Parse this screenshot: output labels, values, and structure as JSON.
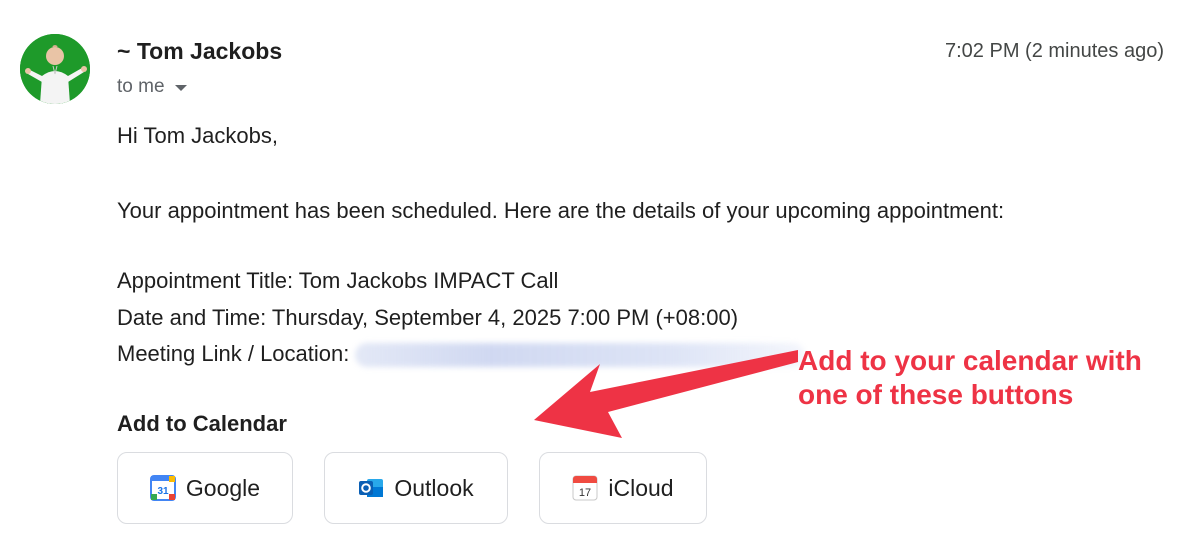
{
  "header": {
    "sender": "~ Tom Jackobs",
    "timestamp": "7:02 PM (2 minutes ago)",
    "recipient": "to me"
  },
  "body": {
    "greeting": "Hi Tom Jackobs,",
    "intro": "Your appointment has been scheduled. Here are the details of your upcoming appointment:",
    "title_line": "Appointment Title: Tom Jackobs IMPACT Call",
    "datetime_line": "Date and Time: Thursday, September 4, 2025 7:00 PM (+08:00)",
    "location_label": "Meeting Link / Location:"
  },
  "calendar": {
    "heading": "Add to Calendar",
    "buttons": [
      {
        "label": "Google",
        "icon": "google-calendar-icon"
      },
      {
        "label": "Outlook",
        "icon": "outlook-icon"
      },
      {
        "label": "iCloud",
        "icon": "icloud-calendar-icon"
      }
    ],
    "google_icon_date": "31",
    "icloud_icon_date": "17"
  },
  "annotation": {
    "line1": "Add to your calendar with",
    "line2": "one of these buttons",
    "color": "#ee3345"
  }
}
